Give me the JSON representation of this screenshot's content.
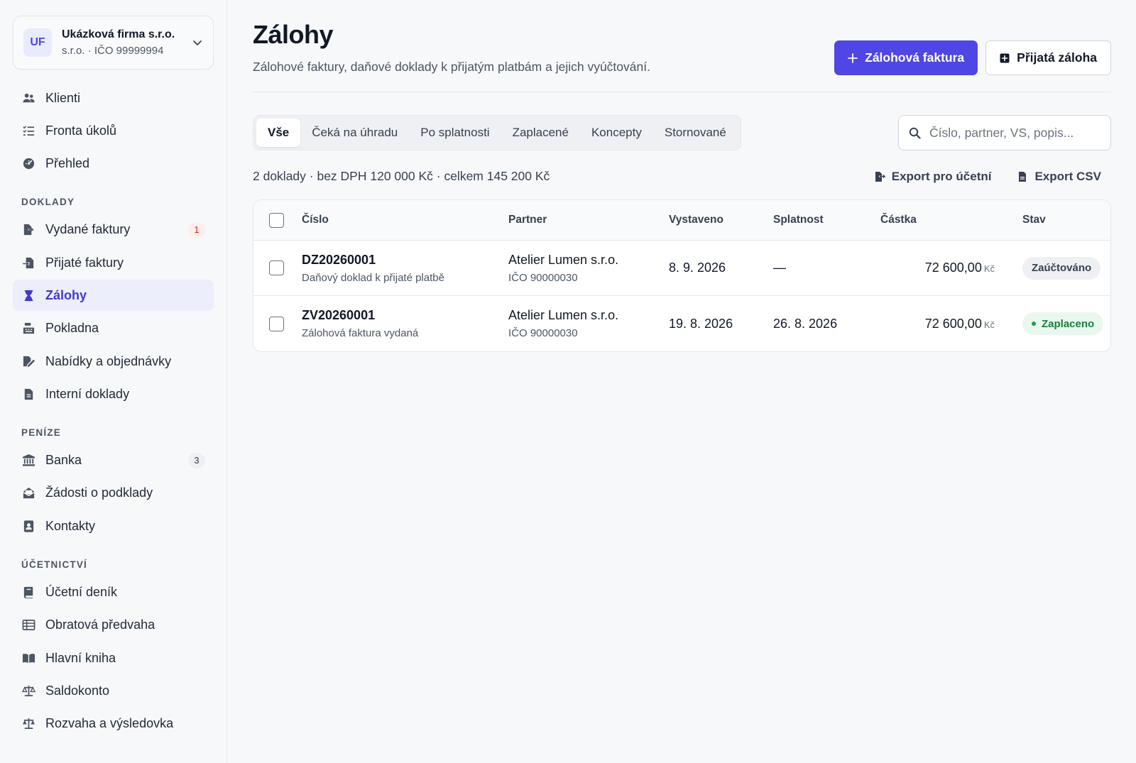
{
  "company": {
    "initials": "UF",
    "name": "Ukázková firma s.r.o.",
    "subtitle": "s.r.o. · IČO 99999994"
  },
  "sidebar": {
    "top_items": [
      {
        "label": "Klienti",
        "icon": "users-icon"
      },
      {
        "label": "Fronta úkolů",
        "icon": "list-icon"
      },
      {
        "label": "Přehled",
        "icon": "dashboard-icon"
      }
    ],
    "sections": [
      {
        "label": "DOKLADY",
        "items": [
          {
            "label": "Vydané faktury",
            "icon": "file-export-icon",
            "badge": "1"
          },
          {
            "label": "Přijaté faktury",
            "icon": "file-import-icon"
          },
          {
            "label": "Zálohy",
            "icon": "hourglass-icon",
            "active": true
          },
          {
            "label": "Pokladna",
            "icon": "cash-register-icon"
          },
          {
            "label": "Nabídky a objednávky",
            "icon": "file-signature-icon"
          },
          {
            "label": "Interní doklady",
            "icon": "file-icon"
          }
        ]
      },
      {
        "label": "PENÍZE",
        "items": [
          {
            "label": "Banka",
            "icon": "bank-icon",
            "badge": "3"
          },
          {
            "label": "Žádosti o podklady",
            "icon": "envelope-open-icon"
          },
          {
            "label": "Kontakty",
            "icon": "address-book-icon"
          }
        ]
      },
      {
        "label": "ÚČETNICTVÍ",
        "items": [
          {
            "label": "Účetní deník",
            "icon": "book-icon"
          },
          {
            "label": "Obratová předvaha",
            "icon": "table-icon"
          },
          {
            "label": "Hlavní kniha",
            "icon": "book-open-icon"
          },
          {
            "label": "Saldokonto",
            "icon": "scale-icon"
          },
          {
            "label": "Rozvaha a výsledovka",
            "icon": "scale-balanced-icon"
          }
        ]
      }
    ]
  },
  "page": {
    "title": "Zálohy",
    "subtitle": "Zálohové faktury, daňové doklady k přijatým platbám a jejich vyúčtování.",
    "primary_button": "Zálohová faktura",
    "secondary_button": "Přijatá záloha"
  },
  "tabs": [
    "Vše",
    "Čeká na úhradu",
    "Po splatnosti",
    "Zaplacené",
    "Koncepty",
    "Stornované"
  ],
  "search": {
    "placeholder": "Číslo, partner, VS, popis..."
  },
  "summary": "2 doklady · bez DPH 120 000 Kč · celkem 145 200 Kč",
  "exports": {
    "accountant": "Export pro účetní",
    "csv": "Export CSV"
  },
  "table": {
    "headers": {
      "number": "Číslo",
      "partner": "Partner",
      "issued": "Vystaveno",
      "due": "Splatnost",
      "amount": "Částka",
      "status": "Stav"
    },
    "rows": [
      {
        "number": "DZ20260001",
        "description": "Daňový doklad k přijaté platbě",
        "partner": "Atelier Lumen s.r.o.",
        "ico": "IČO 90000030",
        "issued": "8. 9. 2026",
        "due": "—",
        "amount": "72 600,00",
        "currency": "Kč",
        "status": "Zaúčtováno",
        "status_kind": "gray"
      },
      {
        "number": "ZV20260001",
        "description": "Zálohová faktura vydaná",
        "partner": "Atelier Lumen s.r.o.",
        "ico": "IČO 90000030",
        "issued": "19. 8. 2026",
        "due": "26. 8. 2026",
        "amount": "72 600,00",
        "currency": "Kč",
        "status": "Zaplaceno",
        "status_kind": "green"
      }
    ]
  },
  "colors": {
    "accent": "#4f46e5",
    "active_bg": "#eceefc",
    "success": "#15803d",
    "danger": "#dc2626"
  }
}
